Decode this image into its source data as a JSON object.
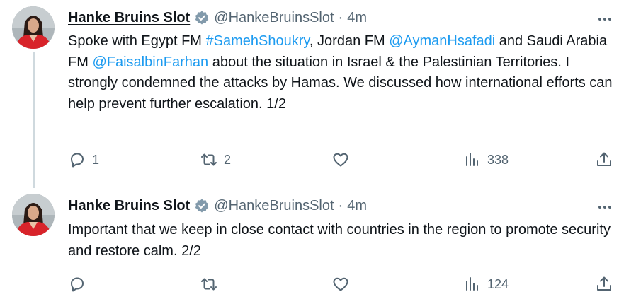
{
  "tweets": [
    {
      "author": "Hanke Bruins Slot",
      "handle": "@HankeBruinsSlot",
      "separator": "·",
      "time": "4m",
      "text_parts": [
        {
          "t": "Spoke with Egypt FM ",
          "link": false
        },
        {
          "t": "#SamehShoukry",
          "link": true
        },
        {
          "t": ", Jordan FM ",
          "link": false
        },
        {
          "t": "@AymanHsafadi",
          "link": true
        },
        {
          "t": " and Saudi Arabia FM ",
          "link": false
        },
        {
          "t": "@FaisalbinFarhan",
          "link": true
        },
        {
          "t": " about the situation in Israel & the Palestinian Territories. I strongly condemned the attacks by Hamas. We discussed how international efforts can help prevent further escalation. 1/2",
          "link": false
        }
      ],
      "replies": "1",
      "retweets": "2",
      "likes": "",
      "views": "338"
    },
    {
      "author": "Hanke Bruins Slot",
      "handle": "@HankeBruinsSlot",
      "separator": "·",
      "time": "4m",
      "text_parts": [
        {
          "t": "Important that we keep in close contact with countries in the region to promote security and restore calm. 2/2",
          "link": false
        }
      ],
      "replies": "",
      "retweets": "",
      "likes": "",
      "views": "124"
    }
  ],
  "colors": {
    "link": "#1d9bf0",
    "secondary": "#536471",
    "verified": "#829aab",
    "thread_line": "#cfd9de"
  },
  "icons": [
    "more-icon",
    "verified-badge-icon",
    "reply-icon",
    "retweet-icon",
    "like-icon",
    "views-icon",
    "share-icon"
  ]
}
